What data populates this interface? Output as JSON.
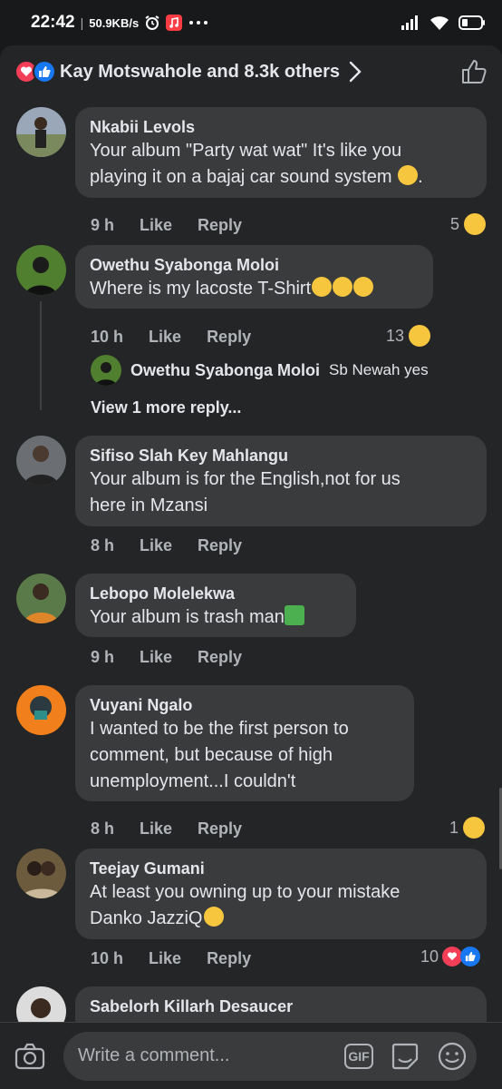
{
  "status_bar": {
    "time": "22:42",
    "speed": "50.9KB/s",
    "icons": [
      "alarm-icon",
      "music-app-icon",
      "more-dots-icon",
      "signal-icon",
      "wifi-icon",
      "battery-icon"
    ]
  },
  "header": {
    "reactions_text": "Kay Motswahole and 8.3k others",
    "icons": [
      "love-reaction-icon",
      "like-reaction-icon",
      "chevron-right-icon",
      "thumbs-up-icon"
    ]
  },
  "comments": [
    {
      "author": "Nkabii Levols",
      "lines": [
        "Your album \"Party wat wat\" It's like you",
        "playing it on a bajaj car sound system",
        "."
      ],
      "time": "9 h",
      "like": "Like",
      "reply": "Reply",
      "reactions": "5"
    },
    {
      "author": "Owethu Syabonga Moloi",
      "lines": [
        "Where is my lacoste T-Shirt"
      ],
      "time": "10 h",
      "like": "Like",
      "reply": "Reply",
      "reactions": "13",
      "replies": [
        {
          "author": "Owethu Syabonga Moloi",
          "text": "Sb Newah yes"
        }
      ],
      "view_more": "View 1 more reply..."
    },
    {
      "author": "Sifiso Slah Key Mahlangu",
      "lines": [
        "Your album is for the English,not for us",
        "here in Mzansi"
      ],
      "time": "8 h",
      "like": "Like",
      "reply": "Reply"
    },
    {
      "author": "Lebopo Molelekwa",
      "lines": [
        "Your album is trash man"
      ],
      "time": "9 h",
      "like": "Like",
      "reply": "Reply"
    },
    {
      "author": "Vuyani Ngalo",
      "lines": [
        "I wanted to be the first person to",
        "comment, but because of high",
        "unemployment...I couldn't"
      ],
      "time": "8 h",
      "like": "Like",
      "reply": "Reply",
      "reactions": "1"
    },
    {
      "author": "Teejay Gumani",
      "lines": [
        "At least you owning up to your mistake",
        "Danko JazziQ"
      ],
      "time": "10 h",
      "like": "Like",
      "reply": "Reply",
      "reactions": "10"
    },
    {
      "author": "Sabelorh Killarh Desaucer"
    }
  ],
  "composer": {
    "placeholder": "Write a comment...",
    "gif_label": "GIF",
    "icons": [
      "camera-icon",
      "gif-icon",
      "sticker-icon",
      "emoji-icon"
    ]
  },
  "colors": {
    "background": "#242526",
    "bubble": "#3a3b3c",
    "text": "#e4e6eb",
    "muted": "#b0b3b8",
    "like_blue": "#1877f2",
    "love_red": "#f33e58"
  }
}
